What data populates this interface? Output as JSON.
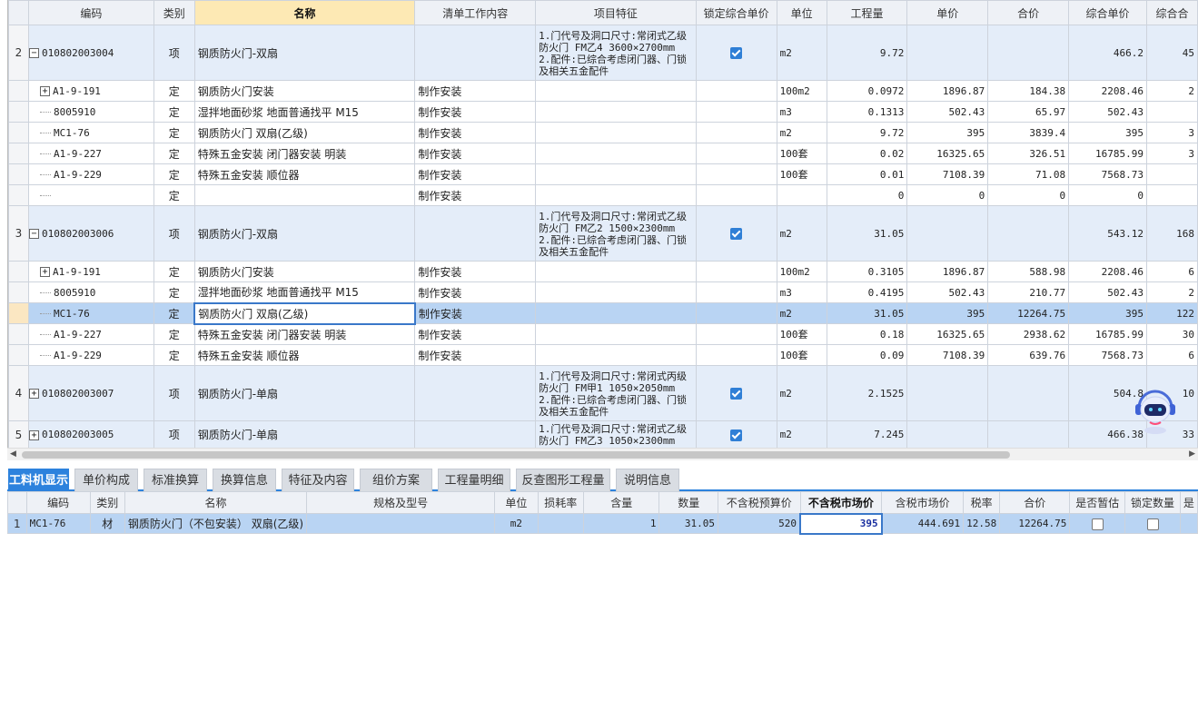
{
  "upper_headers": [
    "",
    "编码",
    "类别",
    "名称",
    "清单工作内容",
    "项目特征",
    "锁定综合单价",
    "单位",
    "工程量",
    "单价",
    "合价",
    "综合单价",
    "综合合"
  ],
  "upper_rows": [
    {
      "kind": "main",
      "num": "2",
      "expander": "−",
      "code": "010802003004",
      "type": "项",
      "name": "钢质防火门-双扇",
      "work": "",
      "feature": "1.门代号及洞口尺寸:常闭式乙级防火门 FM乙4 3600×2700mm\n2.配件:已综合考虑闭门器、门锁及相关五金配件",
      "locked": true,
      "unit": "m2",
      "qty": "9.72",
      "price": "",
      "total": "",
      "comp_price": "466.2",
      "comp_total": "45"
    },
    {
      "kind": "sub",
      "num": "",
      "expander": "+",
      "code": "A1-9-191",
      "type": "定",
      "name": "钢质防火门安装",
      "work": "制作安装",
      "feature": "",
      "unit": "100m2",
      "qty": "0.0972",
      "price": "1896.87",
      "total": "184.38",
      "comp_price": "2208.46",
      "comp_total": "2"
    },
    {
      "kind": "sub",
      "num": "",
      "expander": "",
      "code": "8005910",
      "type": "定",
      "name": "湿拌地面砂浆 地面普通找平 M15",
      "work": "制作安装",
      "feature": "",
      "unit": "m3",
      "qty": "0.1313",
      "price": "502.43",
      "total": "65.97",
      "comp_price": "502.43",
      "comp_total": ""
    },
    {
      "kind": "sub",
      "num": "",
      "expander": "",
      "code": "MC1-76",
      "type": "定",
      "name": "钢质防火门 双扇(乙级)",
      "work": "制作安装",
      "feature": "",
      "unit": "m2",
      "qty": "9.72",
      "price": "395",
      "total": "3839.4",
      "comp_price": "395",
      "comp_total": "3"
    },
    {
      "kind": "sub",
      "num": "",
      "expander": "",
      "code": "A1-9-227",
      "type": "定",
      "name": "特殊五金安装 闭门器安装 明装",
      "work": "制作安装",
      "feature": "",
      "unit": "100套",
      "qty": "0.02",
      "price": "16325.65",
      "total": "326.51",
      "comp_price": "16785.99",
      "comp_total": "3"
    },
    {
      "kind": "sub",
      "num": "",
      "expander": "",
      "code": "A1-9-229",
      "type": "定",
      "name": "特殊五金安装 顺位器",
      "work": "制作安装",
      "feature": "",
      "unit": "100套",
      "qty": "0.01",
      "price": "7108.39",
      "total": "71.08",
      "comp_price": "7568.73",
      "comp_total": ""
    },
    {
      "kind": "sub",
      "num": "",
      "expander": "",
      "code": "",
      "type": "定",
      "name": "",
      "work": "制作安装",
      "feature": "",
      "unit": "",
      "qty": "0",
      "price": "0",
      "total": "0",
      "comp_price": "0",
      "comp_total": ""
    },
    {
      "kind": "main",
      "num": "3",
      "expander": "−",
      "code": "010802003006",
      "type": "项",
      "name": "钢质防火门-双扇",
      "work": "",
      "feature": "1.门代号及洞口尺寸:常闭式乙级防火门 FM乙2 1500×2300mm\n2.配件:已综合考虑闭门器、门锁及相关五金配件",
      "locked": true,
      "unit": "m2",
      "qty": "31.05",
      "price": "",
      "total": "",
      "comp_price": "543.12",
      "comp_total": "168"
    },
    {
      "kind": "sub",
      "num": "",
      "expander": "+",
      "code": "A1-9-191",
      "type": "定",
      "name": "钢质防火门安装",
      "work": "制作安装",
      "feature": "",
      "unit": "100m2",
      "qty": "0.3105",
      "price": "1896.87",
      "total": "588.98",
      "comp_price": "2208.46",
      "comp_total": "6"
    },
    {
      "kind": "sub",
      "num": "",
      "expander": "",
      "code": "8005910",
      "type": "定",
      "name": "湿拌地面砂浆 地面普通找平 M15",
      "work": "制作安装",
      "feature": "",
      "unit": "m3",
      "qty": "0.4195",
      "price": "502.43",
      "total": "210.77",
      "comp_price": "502.43",
      "comp_total": "2"
    },
    {
      "kind": "sel",
      "num": "",
      "expander": "",
      "code": "MC1-76",
      "type": "定",
      "name": "钢质防火门 双扇(乙级)",
      "work": "制作安装",
      "feature": "",
      "unit": "m2",
      "qty": "31.05",
      "price": "395",
      "total": "12264.75",
      "comp_price": "395",
      "comp_total": "122"
    },
    {
      "kind": "sub",
      "num": "",
      "expander": "",
      "code": "A1-9-227",
      "type": "定",
      "name": "特殊五金安装 闭门器安装 明装",
      "work": "制作安装",
      "feature": "",
      "unit": "100套",
      "qty": "0.18",
      "price": "16325.65",
      "total": "2938.62",
      "comp_price": "16785.99",
      "comp_total": "30"
    },
    {
      "kind": "sub",
      "num": "",
      "expander": "",
      "code": "A1-9-229",
      "type": "定",
      "name": "特殊五金安装 顺位器",
      "work": "制作安装",
      "feature": "",
      "unit": "100套",
      "qty": "0.09",
      "price": "7108.39",
      "total": "639.76",
      "comp_price": "7568.73",
      "comp_total": "6"
    },
    {
      "kind": "main",
      "num": "4",
      "expander": "+",
      "code": "010802003007",
      "type": "项",
      "name": "钢质防火门-单扇",
      "work": "",
      "feature": "1.门代号及洞口尺寸:常闭式丙级防火门 FM甲1 1050×2050mm\n2.配件:已综合考虑闭门器、门锁及相关五金配件",
      "locked": true,
      "unit": "m2",
      "qty": "2.1525",
      "price": "",
      "total": "",
      "comp_price": "504.8",
      "comp_total": "10"
    },
    {
      "kind": "main",
      "num": "5",
      "expander": "+",
      "code": "010802003005",
      "type": "项",
      "name": "钢质防火门-单扇",
      "work": "",
      "feature": "1.门代号及洞口尺寸:常闭式乙级防火门 FM乙3 1050×2300mm",
      "locked": true,
      "unit": "m2",
      "qty": "7.245",
      "price": "",
      "total": "",
      "comp_price": "466.38",
      "comp_total": "33"
    }
  ],
  "tabs": [
    "工料机显示",
    "单价构成",
    "标准换算",
    "换算信息",
    "特征及内容",
    "组价方案",
    "工程量明细",
    "反查图形工程量",
    "说明信息"
  ],
  "lower_headers": [
    "",
    "编码",
    "类别",
    "名称",
    "规格及型号",
    "单位",
    "损耗率",
    "含量",
    "数量",
    "不含税预算价",
    "不含税市场价",
    "含税市场价",
    "税率",
    "合价",
    "是否暂估",
    "锁定数量",
    "是"
  ],
  "lower_rows": [
    {
      "num": "1",
      "code": "MC1-76",
      "type": "材",
      "name": "钢质防火门（不包安装） 双扇(乙级)",
      "spec": "",
      "unit": "m2",
      "loss": "",
      "content": "1",
      "qty": "31.05",
      "budget_price": "520",
      "market_price": "395",
      "market_price_tax": "444.691",
      "tax_rate": "12.58",
      "total": "12264.75",
      "provisional": false,
      "lock_qty": false
    }
  ],
  "colors": {
    "accent": "#2d82dd",
    "selected_row": "#b9d4f3",
    "group_row": "#e4edf9",
    "highlight_header": "#fde9b4"
  },
  "icons": [
    "robot-assistant-icon",
    "scroll-left-arrow-icon",
    "scroll-right-arrow-icon"
  ]
}
